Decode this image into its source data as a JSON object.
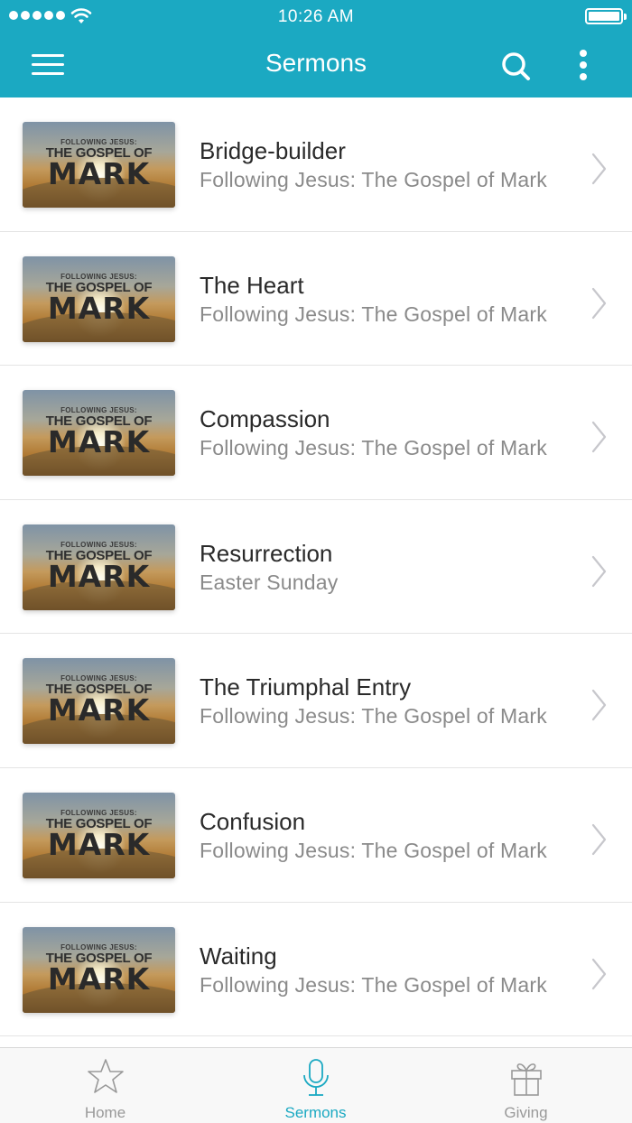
{
  "status_bar": {
    "time": "10:26 AM"
  },
  "nav": {
    "title": "Sermons"
  },
  "icons": {
    "menu": "hamburger-icon",
    "search": "search-icon",
    "more": "more-vertical-icon",
    "chevron": "chevron-right-icon"
  },
  "colors": {
    "accent": "#1ba9c2",
    "tab_inactive": "#999999"
  },
  "thumbnail": {
    "line1": "FOLLOWING JESUS:",
    "line2": "THE GOSPEL OF",
    "line3": "MARK"
  },
  "sermons": [
    {
      "title": "Bridge-builder",
      "subtitle": "Following Jesus: The Gospel of Mark"
    },
    {
      "title": "The Heart",
      "subtitle": "Following Jesus: The Gospel of Mark"
    },
    {
      "title": "Compassion",
      "subtitle": "Following Jesus: The Gospel of Mark"
    },
    {
      "title": "Resurrection",
      "subtitle": "Easter Sunday"
    },
    {
      "title": "The Triumphal Entry",
      "subtitle": "Following Jesus: The Gospel of Mark"
    },
    {
      "title": "Confusion",
      "subtitle": "Following Jesus: The Gospel of Mark"
    },
    {
      "title": "Waiting",
      "subtitle": "Following Jesus: The Gospel of Mark"
    }
  ],
  "tabs": [
    {
      "label": "Home",
      "icon": "star-icon",
      "active": false
    },
    {
      "label": "Sermons",
      "icon": "microphone-icon",
      "active": true
    },
    {
      "label": "Giving",
      "icon": "gift-icon",
      "active": false
    }
  ]
}
